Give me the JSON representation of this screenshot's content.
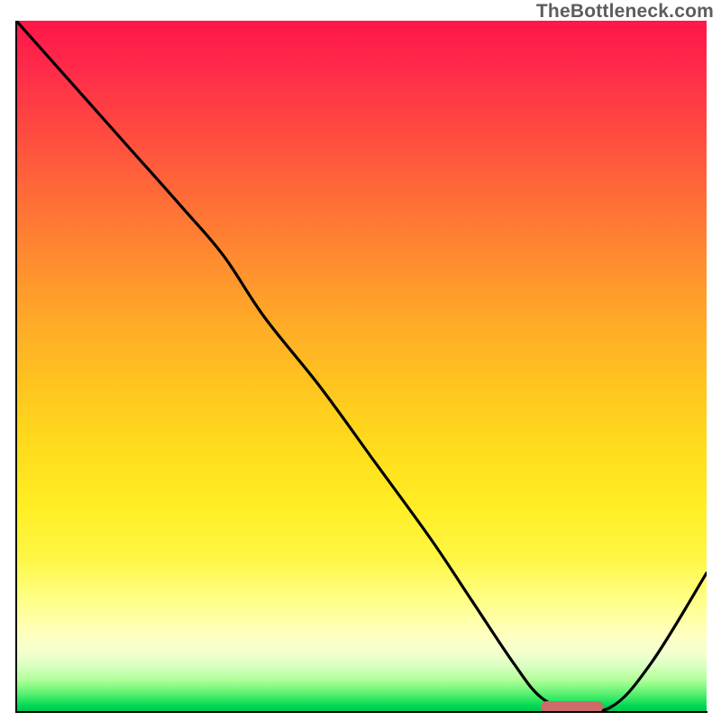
{
  "attribution": "TheBottleneck.com",
  "chart_data": {
    "type": "line",
    "title": "",
    "xlabel": "",
    "ylabel": "",
    "xlim": [
      0,
      100
    ],
    "ylim": [
      0,
      100
    ],
    "x": [
      0,
      8,
      16,
      24,
      30,
      36,
      44,
      52,
      60,
      66,
      72,
      76,
      80,
      86,
      92,
      100
    ],
    "values": [
      100,
      91,
      82,
      73,
      66,
      57,
      47,
      36,
      25,
      16,
      7,
      2,
      0.5,
      0.5,
      7,
      20
    ],
    "marker": {
      "x_start": 76,
      "x_end": 85,
      "y": 0.6
    },
    "gradient_bands": [
      {
        "pos": 0.0,
        "color": "#ff1648"
      },
      {
        "pos": 0.5,
        "color": "#ffc220"
      },
      {
        "pos": 0.85,
        "color": "#ffff88"
      },
      {
        "pos": 1.0,
        "color": "#00c84e"
      }
    ]
  },
  "colors": {
    "curve": "#000000",
    "marker": "#cf6a6a"
  }
}
